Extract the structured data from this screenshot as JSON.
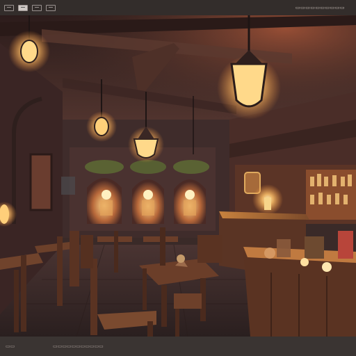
{
  "toolbar": {
    "buttons": [
      {
        "icon": "layout-icon"
      },
      {
        "icon": "image-view-icon"
      },
      {
        "icon": "grid-icon"
      },
      {
        "icon": "fullscreen-icon"
      }
    ],
    "right_label": "▭▭▭▭▭▭▭▭▭▭"
  },
  "statusbar": {
    "left": "▭▭",
    "right": "▭▭▭▭▭▭▭▭▭▭▭"
  },
  "scene": {
    "subject": "fantasy tavern interior",
    "palette": {
      "warm_light": "#ffcf7a",
      "wood": "#5a3526",
      "wall": "#4a2f2c",
      "ceiling": "#3e2624",
      "floor": "#3c2a2a"
    }
  }
}
